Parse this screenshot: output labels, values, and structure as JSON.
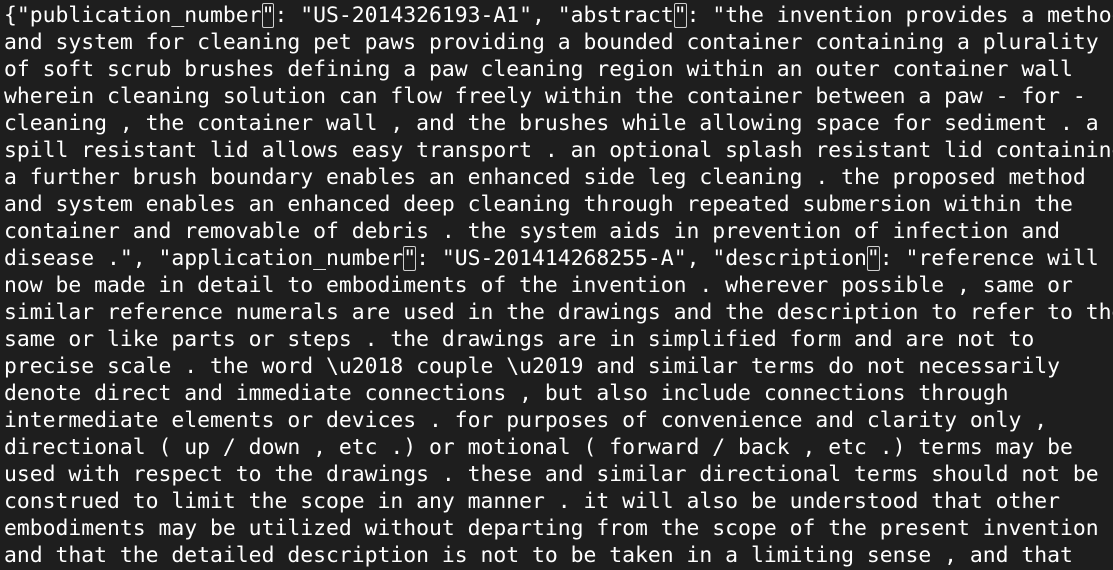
{
  "editor": {
    "lines": [
      {
        "pre": "{\"publication_number",
        "box": "\"",
        "post": ": \"US-2014326193-A1\", \"abstract",
        "box2": "\"",
        "post2": ": \"the invention provides a method"
      },
      {
        "pre": "and system for cleaning pet paws providing a bounded container containing a plurality"
      },
      {
        "pre": "of soft scrub brushes defining a paw cleaning region within an outer container wall"
      },
      {
        "pre": "wherein cleaning solution can flow freely within the container between a paw - for -"
      },
      {
        "pre": "cleaning , the container wall , and the brushes while allowing space for sediment . a"
      },
      {
        "pre": "spill resistant lid allows easy transport . an optional splash resistant lid containing"
      },
      {
        "pre": "a further brush boundary enables an enhanced side leg cleaning . the proposed method"
      },
      {
        "pre": "and system enables an enhanced deep cleaning through repeated submersion within the"
      },
      {
        "pre": "container and removable of debris . the system aids in prevention of infection and"
      },
      {
        "pre": "disease .\", \"application_number",
        "box": "\"",
        "post": ": \"US-201414268255-A\", \"description",
        "box2": "\"",
        "post2": ": \"reference will"
      },
      {
        "pre": "now be made in detail to embodiments of the invention . wherever possible , same or"
      },
      {
        "pre": "similar reference numerals are used in the drawings and the description to refer to the"
      },
      {
        "pre": "same or like parts or steps . the drawings are in simplified form and are not to"
      },
      {
        "pre": "precise scale . the word \\u2018 couple \\u2019 and similar terms do not necessarily"
      },
      {
        "pre": "denote direct and immediate connections , but also include connections through"
      },
      {
        "pre": "intermediate elements or devices . for purposes of convenience and clarity only ,"
      },
      {
        "pre": "directional ( up / down , etc .) or motional ( forward / back , etc .) terms may be"
      },
      {
        "pre": "used with respect to the drawings . these and similar directional terms should not be"
      },
      {
        "pre": "construed to limit the scope in any manner . it will also be understood that other"
      },
      {
        "pre": "embodiments may be utilized without departing from the scope of the present invention ,"
      },
      {
        "pre": "and that the detailed description is not to be taken in a limiting sense , and that"
      }
    ],
    "colors": {
      "background": "#1e1e1e",
      "text": "#ffffff",
      "bracket_match_box": "#d0d0d0"
    }
  }
}
